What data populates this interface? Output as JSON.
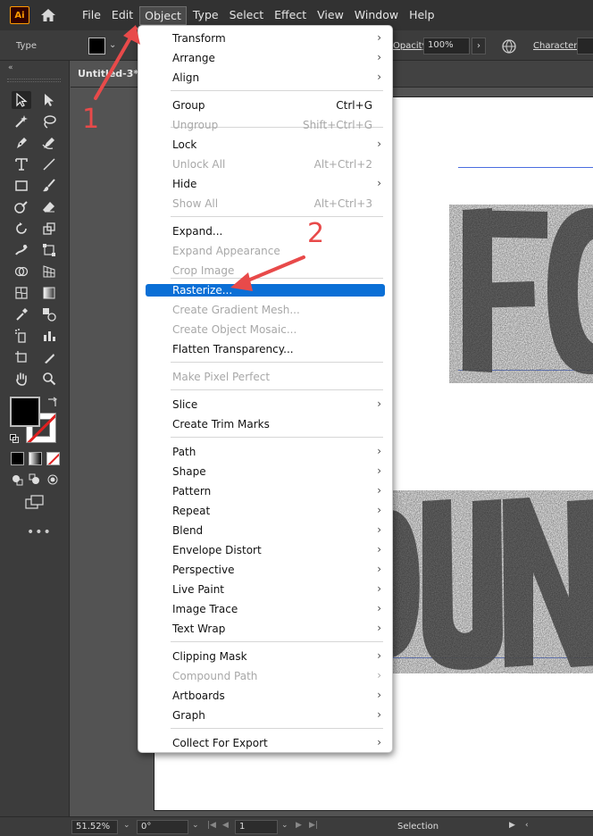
{
  "app": {
    "logo_text": "Ai",
    "accent_color": "#ff9a00",
    "selection_color": "#0a6fd6",
    "annotation_color": "#e84a4a"
  },
  "menubar": {
    "items": [
      "File",
      "Edit",
      "Object",
      "Type",
      "Select",
      "Effect",
      "View",
      "Window",
      "Help"
    ],
    "active": "Object"
  },
  "controlbar": {
    "tool_label": "Type",
    "opacity_label": "Opacity:",
    "opacity_value": "100%",
    "character_label": "Character:"
  },
  "document": {
    "tab_title": "Untitled-3* @"
  },
  "statusbar": {
    "zoom": "51.52%",
    "rotation": "0°",
    "artboard": "1",
    "status": "Selection"
  },
  "dropdown": {
    "items": [
      {
        "label": "Transform",
        "shortcut": "",
        "submenu": true,
        "disabled": false
      },
      {
        "label": "Arrange",
        "shortcut": "",
        "submenu": true,
        "disabled": false
      },
      {
        "label": "Align",
        "shortcut": "",
        "submenu": true,
        "disabled": false
      },
      {
        "label": "Group",
        "shortcut": "Ctrl+G",
        "submenu": false,
        "disabled": false
      },
      {
        "label": "Ungroup",
        "shortcut": "Shift+Ctrl+G",
        "submenu": false,
        "disabled": true
      },
      {
        "label": "Lock",
        "shortcut": "",
        "submenu": true,
        "disabled": false
      },
      {
        "label": "Unlock All",
        "shortcut": "Alt+Ctrl+2",
        "submenu": false,
        "disabled": true
      },
      {
        "label": "Hide",
        "shortcut": "",
        "submenu": true,
        "disabled": false
      },
      {
        "label": "Show All",
        "shortcut": "Alt+Ctrl+3",
        "submenu": false,
        "disabled": true
      },
      {
        "label": "Expand...",
        "shortcut": "",
        "submenu": false,
        "disabled": false
      },
      {
        "label": "Expand Appearance",
        "shortcut": "",
        "submenu": false,
        "disabled": true
      },
      {
        "label": "Crop Image",
        "shortcut": "",
        "submenu": false,
        "disabled": true
      },
      {
        "label": "Rasterize...",
        "shortcut": "",
        "submenu": false,
        "disabled": false,
        "highlighted": true
      },
      {
        "label": "Create Gradient Mesh...",
        "shortcut": "",
        "submenu": false,
        "disabled": true
      },
      {
        "label": "Create Object Mosaic...",
        "shortcut": "",
        "submenu": false,
        "disabled": true
      },
      {
        "label": "Flatten Transparency...",
        "shortcut": "",
        "submenu": false,
        "disabled": false
      },
      {
        "label": "Make Pixel Perfect",
        "shortcut": "",
        "submenu": false,
        "disabled": true
      },
      {
        "label": "Slice",
        "shortcut": "",
        "submenu": true,
        "disabled": false
      },
      {
        "label": "Create Trim Marks",
        "shortcut": "",
        "submenu": false,
        "disabled": false
      },
      {
        "label": "Path",
        "shortcut": "",
        "submenu": true,
        "disabled": false
      },
      {
        "label": "Shape",
        "shortcut": "",
        "submenu": true,
        "disabled": false
      },
      {
        "label": "Pattern",
        "shortcut": "",
        "submenu": true,
        "disabled": false
      },
      {
        "label": "Repeat",
        "shortcut": "",
        "submenu": true,
        "disabled": false
      },
      {
        "label": "Blend",
        "shortcut": "",
        "submenu": true,
        "disabled": false
      },
      {
        "label": "Envelope Distort",
        "shortcut": "",
        "submenu": true,
        "disabled": false
      },
      {
        "label": "Perspective",
        "shortcut": "",
        "submenu": true,
        "disabled": false
      },
      {
        "label": "Live Paint",
        "shortcut": "",
        "submenu": true,
        "disabled": false
      },
      {
        "label": "Image Trace",
        "shortcut": "",
        "submenu": true,
        "disabled": false
      },
      {
        "label": "Text Wrap",
        "shortcut": "",
        "submenu": true,
        "disabled": false
      },
      {
        "label": "Clipping Mask",
        "shortcut": "",
        "submenu": true,
        "disabled": false
      },
      {
        "label": "Compound Path",
        "shortcut": "",
        "submenu": true,
        "disabled": true
      },
      {
        "label": "Artboards",
        "shortcut": "",
        "submenu": true,
        "disabled": false
      },
      {
        "label": "Graph",
        "shortcut": "",
        "submenu": true,
        "disabled": false
      },
      {
        "label": "Collect For Export",
        "shortcut": "",
        "submenu": true,
        "disabled": false
      }
    ]
  },
  "annotations": {
    "step1": "1",
    "step2": "2"
  }
}
